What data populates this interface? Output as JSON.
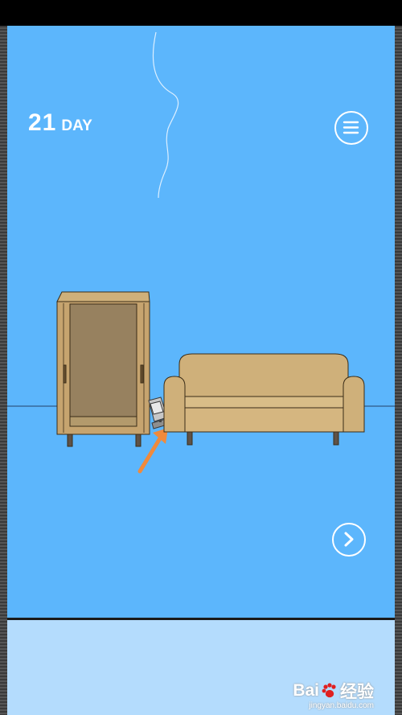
{
  "hud": {
    "day_number": "21",
    "day_label": "DAY"
  },
  "buttons": {
    "menu_icon": "hamburger-menu-icon",
    "next_icon": "chevron-right-icon"
  },
  "scene": {
    "background_color": "#5cb6fc",
    "hint_arrow_color": "#f08a3c",
    "objects": [
      "wardrobe",
      "handheld-console",
      "sofa",
      "smoke-wisp",
      "floor-line"
    ]
  },
  "bottom_panel": {
    "background_color": "#b4dcfd"
  },
  "watermark": {
    "brand_left": "Bai",
    "brand_right": "经验",
    "subtitle": "jingyan.baidu.com"
  }
}
